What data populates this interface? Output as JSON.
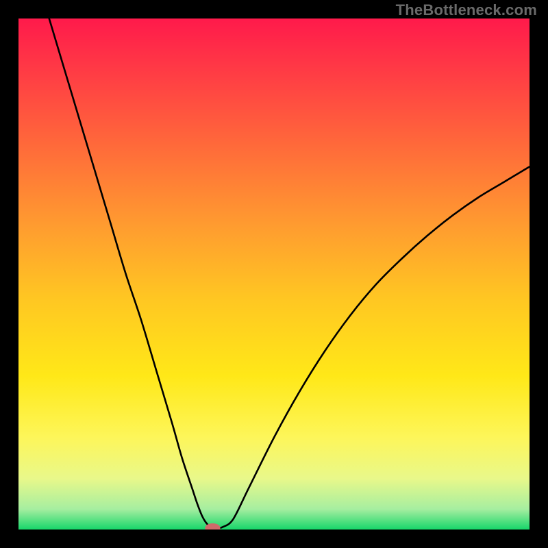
{
  "watermark": "TheBottleneck.com",
  "chart_data": {
    "type": "line",
    "title": "",
    "xlabel": "",
    "ylabel": "",
    "xlim": [
      0,
      100
    ],
    "ylim": [
      0,
      100
    ],
    "grid": false,
    "legend": false,
    "background_gradient_stops": [
      {
        "offset": 0.0,
        "color": "#ff1a4b"
      },
      {
        "offset": 0.1,
        "color": "#ff3a45"
      },
      {
        "offset": 0.25,
        "color": "#ff6a3a"
      },
      {
        "offset": 0.4,
        "color": "#ff9a30"
      },
      {
        "offset": 0.55,
        "color": "#ffc722"
      },
      {
        "offset": 0.7,
        "color": "#ffe818"
      },
      {
        "offset": 0.82,
        "color": "#fdf65a"
      },
      {
        "offset": 0.9,
        "color": "#e9f88a"
      },
      {
        "offset": 0.96,
        "color": "#a6eea0"
      },
      {
        "offset": 1.0,
        "color": "#17d66a"
      }
    ],
    "series": [
      {
        "name": "bottleneck-curve",
        "color": "#000000",
        "x": [
          6,
          9,
          12,
          15,
          18,
          21,
          24,
          27,
          30,
          32,
          34,
          35,
          36,
          37,
          38,
          39,
          40,
          42,
          45,
          50,
          55,
          60,
          65,
          70,
          75,
          80,
          85,
          90,
          95,
          100
        ],
        "y": [
          100,
          90,
          80,
          70,
          60,
          50,
          41,
          31,
          21,
          14,
          8,
          5,
          2.5,
          1,
          0.5,
          0.3,
          0.5,
          2,
          8,
          18,
          27,
          35,
          42,
          48,
          53,
          57.5,
          61.5,
          65,
          68,
          71
        ]
      }
    ],
    "marker": {
      "name": "bottleneck-marker",
      "x": 38,
      "y": 0.3,
      "color": "#d06a6a",
      "rx": 1.5,
      "ry": 0.9
    }
  }
}
